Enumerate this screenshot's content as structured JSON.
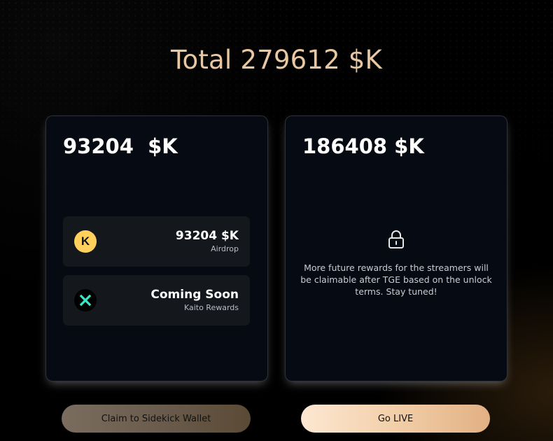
{
  "header": {
    "title": "Total 279612 $K"
  },
  "left_card": {
    "amount": "93204  $K",
    "rewards": [
      {
        "icon": "kaito-k-icon",
        "icon_letter": "K",
        "main": "93204 $K",
        "sub": "Airdrop"
      },
      {
        "icon": "kaito-x-icon",
        "main": "Coming Soon",
        "sub": "Kaito Rewards"
      }
    ]
  },
  "right_card": {
    "amount": "186408 $K",
    "icon": "lock-icon",
    "message": "More future rewards for the streamers will be claimable after TGE based on the unlock terms. Stay tuned!"
  },
  "buttons": {
    "claim_label": "Claim to Sidekick Wallet",
    "live_label": "Go LIVE"
  },
  "colors": {
    "title": "#e9c7a2",
    "kaito_yellow": "#ffd15c",
    "kaito_teal": "#38e8c6",
    "card_bg": "#060a12",
    "row_bg": "#14171c"
  }
}
